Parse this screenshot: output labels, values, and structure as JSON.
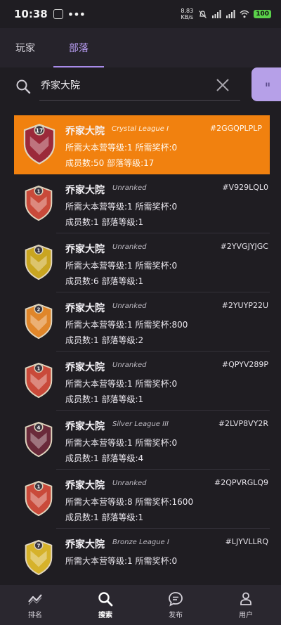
{
  "status_bar": {
    "time": "10:38",
    "net_speed": "8.83",
    "net_unit": "KB/s",
    "battery": "100"
  },
  "tabs": [
    {
      "label": "玩家",
      "active": false
    },
    {
      "label": "部落",
      "active": true
    }
  ],
  "search": {
    "value": "乔家大院",
    "placeholder": ""
  },
  "float_button": {
    "label": "ıı"
  },
  "clans": [
    {
      "name": "乔家大院",
      "league": "Crystal League I",
      "tag": "#2GGQPLPLP",
      "requirements": "所需大本营等级:1  所需奖杯:0",
      "members": "成员数:50  部落等级:17",
      "level": "17",
      "badge_color": "#9b2a3a",
      "selected": true
    },
    {
      "name": "乔家大院",
      "league": "Unranked",
      "tag": "#V929LQL0",
      "requirements": "所需大本营等级:1  所需奖杯:0",
      "members": "成员数:1  部落等级:1",
      "level": "1",
      "badge_color": "#c94a3a",
      "selected": false
    },
    {
      "name": "乔家大院",
      "league": "Unranked",
      "tag": "#2YVGJYJGC",
      "requirements": "所需大本营等级:1  所需奖杯:0",
      "members": "成员数:6  部落等级:1",
      "level": "1",
      "badge_color": "#c9a520",
      "selected": false
    },
    {
      "name": "乔家大院",
      "league": "Unranked",
      "tag": "#2YUYP22U",
      "requirements": "所需大本营等级:1  所需奖杯:800",
      "members": "成员数:1  部落等级:2",
      "level": "2",
      "badge_color": "#e0862a",
      "selected": false
    },
    {
      "name": "乔家大院",
      "league": "Unranked",
      "tag": "#QPYV289P",
      "requirements": "所需大本营等级:1  所需奖杯:0",
      "members": "成员数:1  部落等级:1",
      "level": "1",
      "badge_color": "#c94a3a",
      "selected": false
    },
    {
      "name": "乔家大院",
      "league": "Silver League III",
      "tag": "#2LVP8VY2R",
      "requirements": "所需大本营等级:1  所需奖杯:0",
      "members": "成员数:1  部落等级:4",
      "level": "4",
      "badge_color": "#6a2a3a",
      "selected": false
    },
    {
      "name": "乔家大院",
      "league": "Unranked",
      "tag": "#2QPVRGLQ9",
      "requirements": "所需大本营等级:8  所需奖杯:1600",
      "members": "成员数:1  部落等级:1",
      "level": "1",
      "badge_color": "#c94a3a",
      "selected": false
    },
    {
      "name": "乔家大院",
      "league": "Bronze League I",
      "tag": "#LJYVLLRQ",
      "requirements": "所需大本营等级:1  所需奖杯:0",
      "members": "",
      "level": "7",
      "badge_color": "#d6b22a",
      "selected": false
    }
  ],
  "bottom_nav": [
    {
      "label": "排名",
      "icon": "ranking-icon",
      "active": false
    },
    {
      "label": "搜索",
      "icon": "search-icon",
      "active": true
    },
    {
      "label": "发布",
      "icon": "chat-icon",
      "active": false
    },
    {
      "label": "用户",
      "icon": "user-icon",
      "active": false
    }
  ],
  "colors": {
    "accent": "#a88bea",
    "selected_row": "#f1810f",
    "background": "#1f1d22"
  }
}
